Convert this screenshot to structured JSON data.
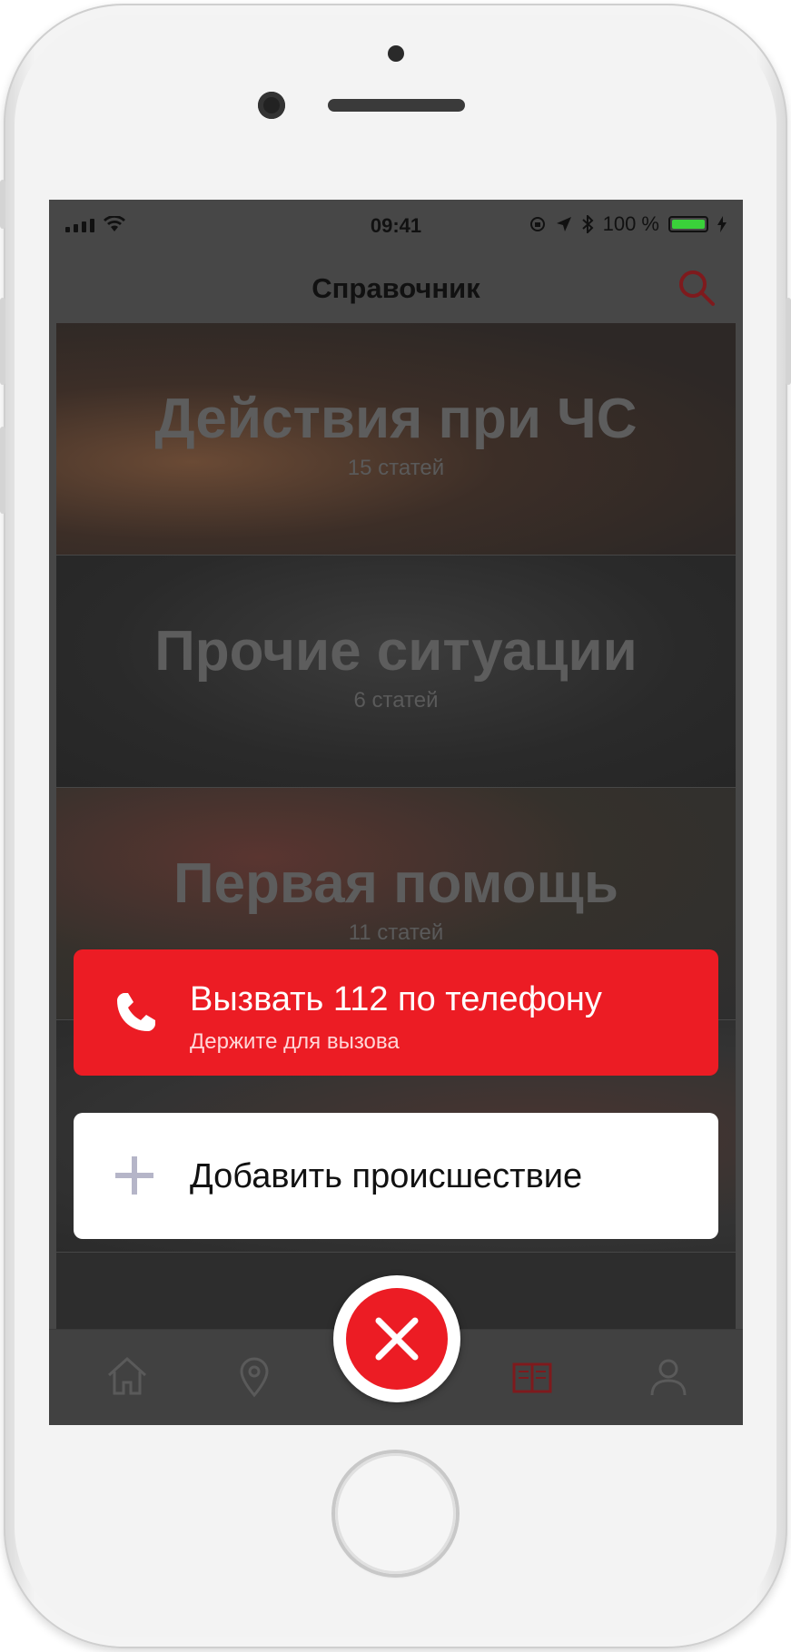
{
  "status_bar": {
    "time": "09:41",
    "battery": "100 %"
  },
  "header": {
    "title": "Справочник"
  },
  "categories": [
    {
      "title": "Действия при ЧС",
      "count": "15 статей"
    },
    {
      "title": "Прочие ситуации",
      "count": "6 статей"
    },
    {
      "title": "Первая помощь",
      "count": "11 статей"
    }
  ],
  "actions": {
    "call": {
      "title": "Вызвать 112 по телефону",
      "subtitle": "Держите для вызова"
    },
    "add": {
      "label": "Добавить происшествие"
    }
  },
  "tabs": [
    "home-icon",
    "location-pin-icon",
    "book-icon",
    "profile-icon"
  ],
  "colors": {
    "accent": "#ec1c24",
    "overlay": "#474747"
  }
}
